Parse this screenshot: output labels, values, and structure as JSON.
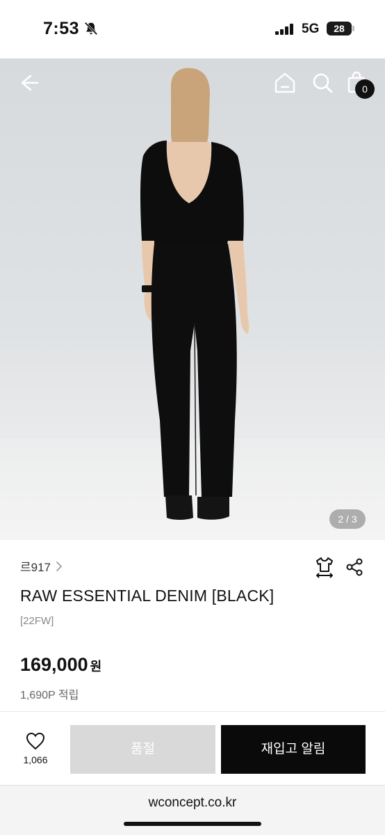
{
  "status_bar": {
    "time": "7:53",
    "network": "5G",
    "battery": "28"
  },
  "hero": {
    "cart_count": "0",
    "page_indicator": "2 / 3",
    "icons": [
      "back-arrow-icon",
      "home-icon",
      "search-icon",
      "shopping-bag-icon"
    ]
  },
  "product": {
    "brand": "르917",
    "name": "RAW ESSENTIAL DENIM [BLACK]",
    "season": "[22FW]",
    "price": "169,000",
    "currency": "원",
    "points": "1,690P 적립"
  },
  "actions": {
    "like_count": "1,066",
    "soldout_label": "품절",
    "restock_label": "재입고 알림"
  },
  "browser": {
    "url": "wconcept.co.kr"
  },
  "colors": {
    "primary_button": "#0a0a0a",
    "disabled_button": "#d9d9d9",
    "hero_background": "#dcdfe1"
  }
}
